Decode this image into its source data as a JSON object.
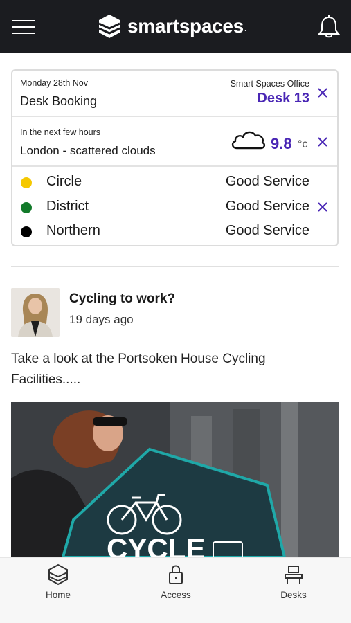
{
  "app": {
    "brand_name": "smartspaces",
    "brand_mark": "."
  },
  "booking": {
    "date": "Monday 28th Nov",
    "title": "Desk Booking",
    "office": "Smart Spaces Office",
    "desk": "Desk 13"
  },
  "weather": {
    "caption": "In the next few hours",
    "summary": "London - scattered clouds",
    "temperature": "9.8",
    "unit": "°c",
    "icon": "cloud-icon"
  },
  "transport": {
    "lines": [
      {
        "name": "Circle",
        "status": "Good Service",
        "color": "#f5c800"
      },
      {
        "name": "District",
        "status": "Good Service",
        "color": "#127a2a"
      },
      {
        "name": "Northern",
        "status": "Good Service",
        "color": "#000000"
      }
    ]
  },
  "post": {
    "title": "Cycling to work?",
    "time": "19 days ago",
    "body": "Take a look at the Portsoken House Cycling Facilities....."
  },
  "tabs": [
    {
      "label": "Home",
      "icon": "home-icon"
    },
    {
      "label": "Access",
      "icon": "lock-icon"
    },
    {
      "label": "Desks",
      "icon": "desk-icon"
    }
  ],
  "colors": {
    "topbar": "#1b1c20",
    "accent": "#4a27b5",
    "teal": "#1fa8a8"
  }
}
